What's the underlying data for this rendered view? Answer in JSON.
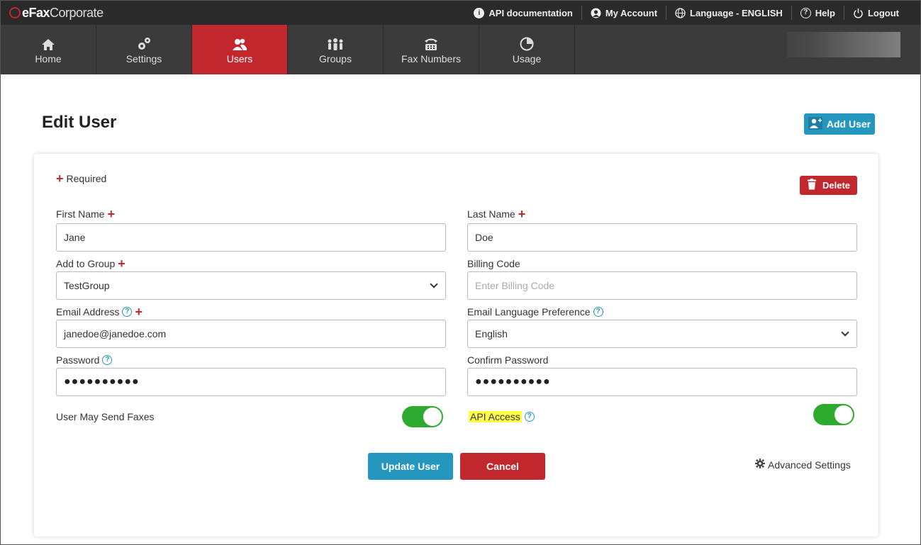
{
  "brand": {
    "bold": "eFax",
    "light": "Corporate"
  },
  "toplinks": [
    {
      "label": "API documentation",
      "icon": "info-icon"
    },
    {
      "label": "My Account",
      "icon": "user-icon"
    },
    {
      "label": "Language - ENGLISH",
      "icon": "globe-icon"
    },
    {
      "label": "Help",
      "icon": "help-icon"
    },
    {
      "label": "Logout",
      "icon": "power-icon"
    }
  ],
  "nav": [
    {
      "label": "Home",
      "icon": "home-icon"
    },
    {
      "label": "Settings",
      "icon": "gears-icon"
    },
    {
      "label": "Users",
      "icon": "users-icon",
      "active": true
    },
    {
      "label": "Groups",
      "icon": "groups-icon"
    },
    {
      "label": "Fax Numbers",
      "icon": "fax-icon"
    },
    {
      "label": "Usage",
      "icon": "pie-chart-icon"
    }
  ],
  "page": {
    "title": "Edit User",
    "add_user": "Add User"
  },
  "form": {
    "required": "Required",
    "delete": "Delete",
    "first_name": {
      "label": "First Name",
      "value": "Jane"
    },
    "last_name": {
      "label": "Last Name",
      "value": "Doe"
    },
    "group": {
      "label": "Add to Group",
      "value": "TestGroup"
    },
    "billing": {
      "label": "Billing Code",
      "placeholder": "Enter Billing Code"
    },
    "email": {
      "label": "Email Address",
      "value": "janedoe@janedoe.com"
    },
    "email_lang": {
      "label": "Email Language Preference",
      "value": "English"
    },
    "password": {
      "label": "Password",
      "value": "●●●●●●●●●●"
    },
    "confirm_password": {
      "label": "Confirm Password",
      "value": "●●●●●●●●●●"
    },
    "send_faxes": {
      "label": "User May Send Faxes",
      "on": true
    },
    "api_access": {
      "label": "API Access",
      "on": true
    },
    "update": "Update User",
    "cancel": "Cancel",
    "advanced": "Advanced Settings"
  },
  "colors": {
    "brand_red": "#c1272d",
    "accent_blue": "#2596be",
    "toggle_green": "#2eab2e",
    "highlight": "#ffff44"
  }
}
